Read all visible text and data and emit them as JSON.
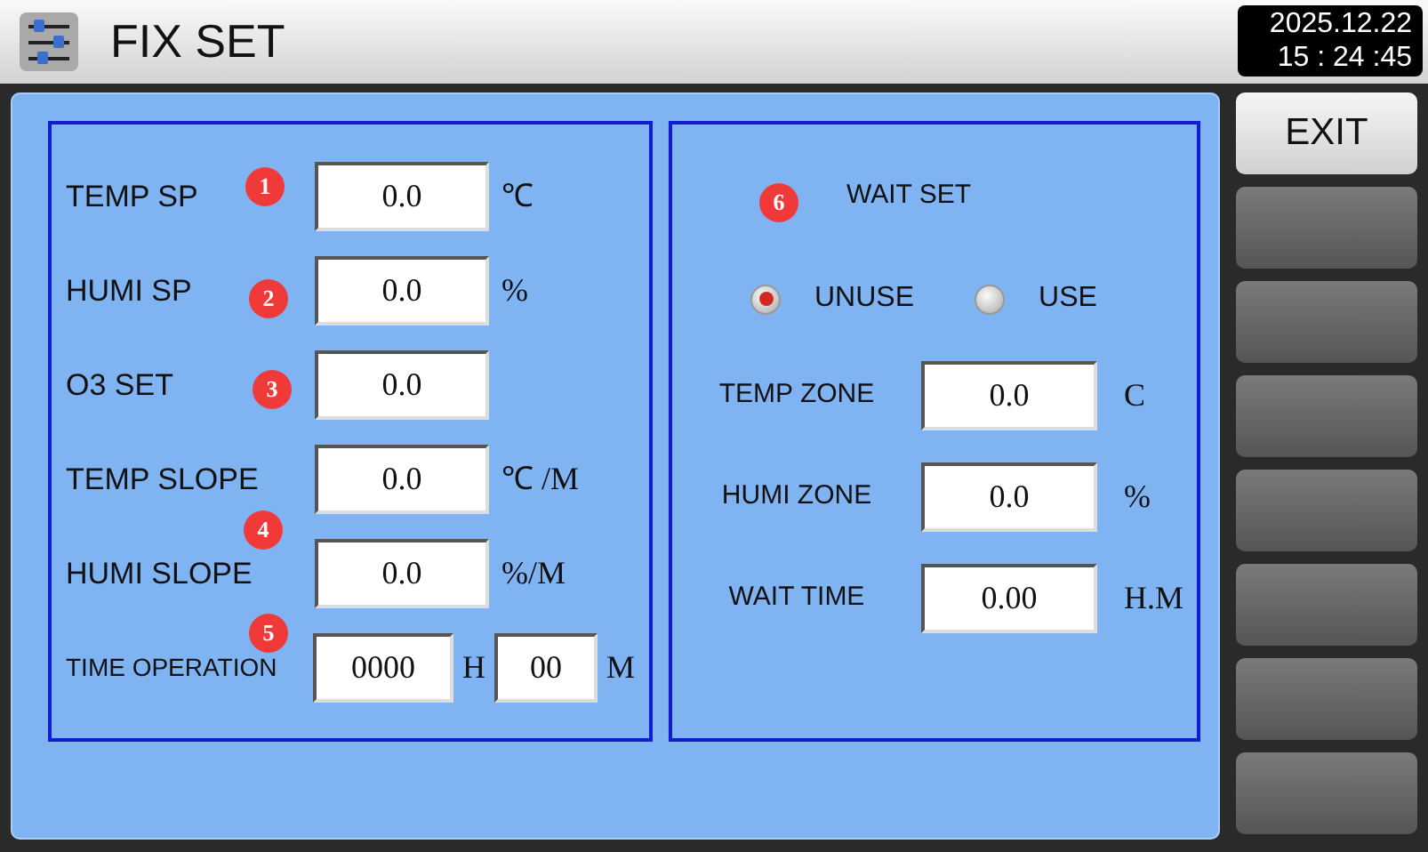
{
  "header": {
    "title": "FIX SET",
    "date": "2025.12.22",
    "time": "15 : 24 :45"
  },
  "settings": [
    {
      "kind": "single",
      "label": "TEMP SP",
      "value": "0.0",
      "unit": "℃"
    },
    {
      "kind": "single",
      "label": "HUMI SP",
      "value": "0.0",
      "unit": "%"
    },
    {
      "kind": "single",
      "label": "O3 SET",
      "value": "0.0"
    },
    {
      "kind": "single",
      "label": "TEMP SLOPE",
      "value": "0.0",
      "unit": "℃ /M"
    },
    {
      "kind": "single",
      "label": "HUMI SLOPE",
      "value": "0.0",
      "unit": "%/M"
    },
    {
      "kind": "double",
      "label": "TIME OPERATION",
      "value": "0000",
      "unit": "H",
      "value_2": "00",
      "unit_2": "M"
    }
  ],
  "markers": [
    "1",
    "2",
    "3",
    "4",
    "5",
    "6"
  ],
  "wait_set": {
    "title": "WAIT SET",
    "options": [
      {
        "label": "UNUSE",
        "selected": true
      },
      {
        "label": "USE",
        "selected": false
      }
    ],
    "fields": [
      {
        "label": "TEMP ZONE",
        "value": "0.0",
        "unit": "C"
      },
      {
        "label": "HUMI ZONE",
        "value": "0.0",
        "unit": "%"
      },
      {
        "label": "WAIT TIME",
        "value": "0.00",
        "unit": "H.M"
      }
    ]
  },
  "side_buttons": [
    {
      "kind": "labeled",
      "label": "EXIT"
    },
    {
      "kind": "blank"
    },
    {
      "kind": "blank"
    },
    {
      "kind": "blank"
    },
    {
      "kind": "blank"
    },
    {
      "kind": "blank"
    },
    {
      "kind": "blank"
    },
    {
      "kind": "blank"
    }
  ]
}
